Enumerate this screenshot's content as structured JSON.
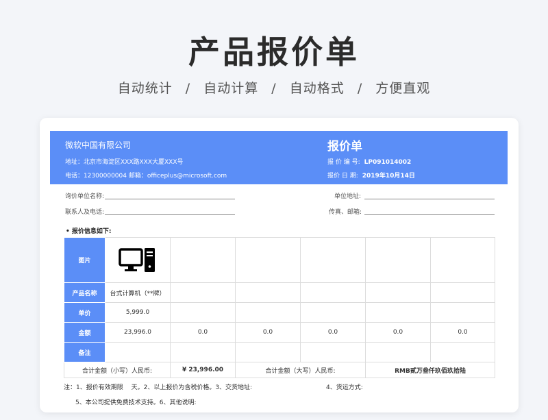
{
  "hero": {
    "title": "产品报价单",
    "tags": [
      "自动统计",
      "自动计算",
      "自动格式",
      "方便直观"
    ],
    "separator": "/"
  },
  "banner": {
    "company": "微软中国有限公司",
    "address": "地址：北京市海淀区XXX路XXX大厦XXX号",
    "contact": "电话：12300000004 邮箱：officeplus@microsoft.com",
    "doc_title": "报价单",
    "quote_no_label": "报 价 编 号:",
    "quote_no": "LP091014002",
    "quote_date_label": "报价 日 期:",
    "quote_date": "2019年10月14日"
  },
  "form": {
    "inquiry_unit": "询价单位名称:",
    "unit_address": "单位地址:",
    "contact_phone": "联系人及电话:",
    "fax_email": "传真、邮箱:"
  },
  "section_label": "• 报价信息如下:",
  "table": {
    "row_labels": {
      "image": "图片",
      "product": "产品名称",
      "price": "单价",
      "amount": "金额",
      "remark": "备注"
    },
    "product_name": "台式计算机（**牌）",
    "unit_price": "5,999.0",
    "amounts": [
      "23,996.0",
      "0.0",
      "0.0",
      "0.0",
      "0.0",
      "0.0"
    ],
    "total_lower_label": "合计金额（小写）人民币:",
    "total_lower_value": "¥ 23,996.00",
    "total_upper_label": "合计金额（大写）人民币:",
    "total_upper_value": "RMB贰万叁仟玖佰玖拾陆"
  },
  "notes": {
    "line1_a": "注：1、报价有效期限　 天。2、以上报价为含税价格。3、交货地址:",
    "line1_b": "4、货运方式:",
    "line2": "5、本公司提供免费技术支持。6、其他说明:"
  },
  "colors": {
    "accent": "#5b8ef7",
    "background": "#f3f5f9"
  }
}
